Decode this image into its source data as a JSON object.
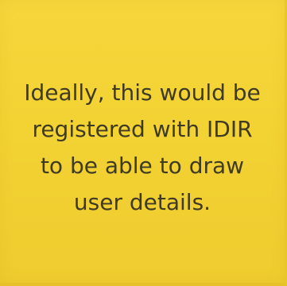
{
  "note": {
    "text": "Ideally, this would be registered with IDIR to be able to draw user details.",
    "background_color": "#f3d234",
    "text_color": "#3f3a24"
  }
}
